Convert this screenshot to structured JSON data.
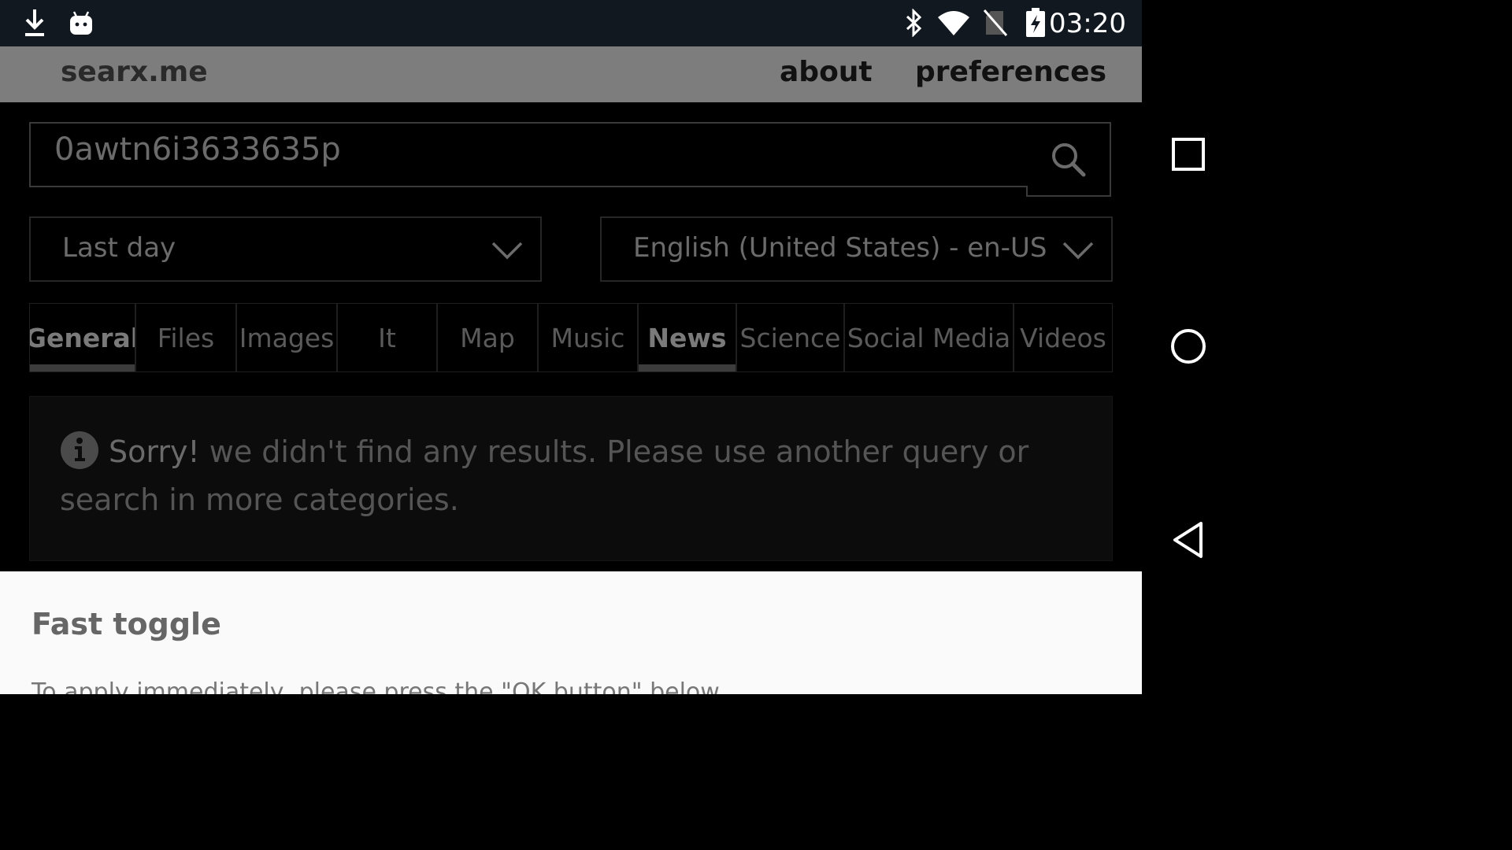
{
  "status_bar": {
    "time": "03:20",
    "icons": [
      "download-icon",
      "android-robot-icon",
      "bluetooth-icon",
      "wifi-icon",
      "no-sim-icon",
      "battery-charging-icon"
    ]
  },
  "nav_bar": {
    "buttons": [
      "recents-button",
      "home-button",
      "back-button"
    ]
  },
  "header": {
    "brand": "searx.me",
    "links": {
      "about": "about",
      "preferences": "preferences"
    }
  },
  "search": {
    "query": "0awtn6i3633635p",
    "button_icon": "search-icon"
  },
  "filters": {
    "time_range": "Last day",
    "language": "English (United States) - en-US"
  },
  "categories": {
    "tabs": [
      {
        "label": "General",
        "active": true
      },
      {
        "label": "Files",
        "active": false
      },
      {
        "label": "Images",
        "active": false
      },
      {
        "label": "It",
        "active": false
      },
      {
        "label": "Map",
        "active": false
      },
      {
        "label": "Music",
        "active": false
      },
      {
        "label": "News",
        "active": true
      },
      {
        "label": "Science",
        "active": false
      },
      {
        "label": "Social Media",
        "active": false
      },
      {
        "label": "Videos",
        "active": false
      }
    ]
  },
  "notice": {
    "icon": "info-icon",
    "strong": "Sorry!",
    "text": " we didn't find any results. Please use another query or search in more categories."
  },
  "sheet": {
    "title": "Fast toggle",
    "body": "To apply immediately, please press the \"OK button\" below."
  },
  "colors": {
    "status_bar_bg": "#121820",
    "header_bg": "#7d7d7d",
    "sheet_bg": "#fafafa"
  }
}
